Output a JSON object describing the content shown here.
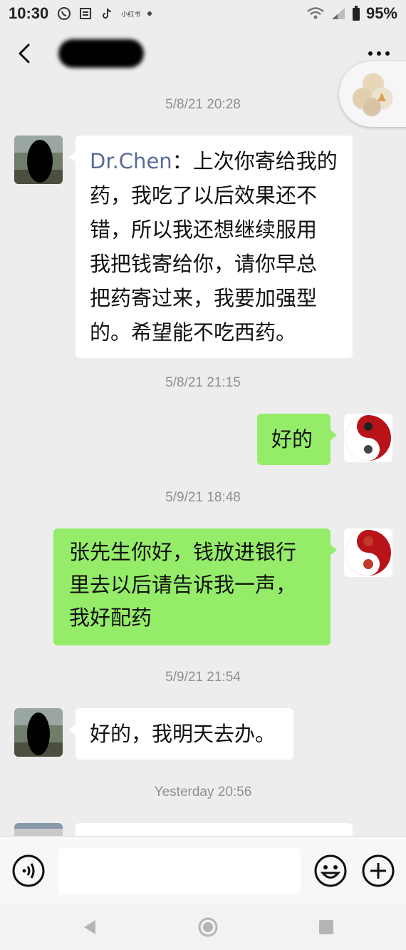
{
  "status_bar": {
    "time": "10:30",
    "battery": "95%",
    "mini_icon_label": "小红书"
  },
  "header": {
    "more_label": "..."
  },
  "messages": [
    {
      "timestamp": "5/8/21 20:28"
    },
    {
      "sender": "Dr.Chen",
      "colon": "：",
      "text": "上次你寄给我的药，我吃了以后效果还不错，所以我还想继续服用我把钱寄给你，请你早总把药寄过来，我要加强型的。希望能不吃西药。"
    },
    {
      "timestamp": "5/8/21 21:15"
    },
    {
      "text": "好的"
    },
    {
      "timestamp": "5/9/21 18:48"
    },
    {
      "text": "张先生你好，钱放进银行里去以后请告诉我一声，我好配药"
    },
    {
      "timestamp": "5/9/21 21:54"
    },
    {
      "text": "好的，我明天去办。"
    },
    {
      "timestamp": "Yesterday 20:56"
    }
  ],
  "lines": {
    "m1": [
      "上次你寄给我的",
      "药，我吃了以后效果还不",
      "错，所以我还想继续服用",
      "我把钱寄给你，请你早总",
      "把药寄过来，我要加强型",
      "的。希望能不吃西药。"
    ],
    "m3": [
      "张先生你好，钱放进银行",
      "里去以后请告诉我一声，",
      "我好配药"
    ]
  },
  "input": {
    "value": "",
    "placeholder": ""
  },
  "icons": {
    "back": "back-arrow-icon",
    "more": "more-dots-icon",
    "voice": "voice-icon",
    "emoji": "emoji-icon",
    "add": "plus-icon",
    "nav_back": "nav-back-icon",
    "nav_home": "nav-home-icon",
    "nav_recents": "nav-recents-icon"
  },
  "colors": {
    "incoming_bubble": "#ffffff",
    "outgoing_bubble": "#95ec69",
    "sender_name": "#576b95",
    "timestamp": "#8f8f8f",
    "background": "#ededed"
  }
}
